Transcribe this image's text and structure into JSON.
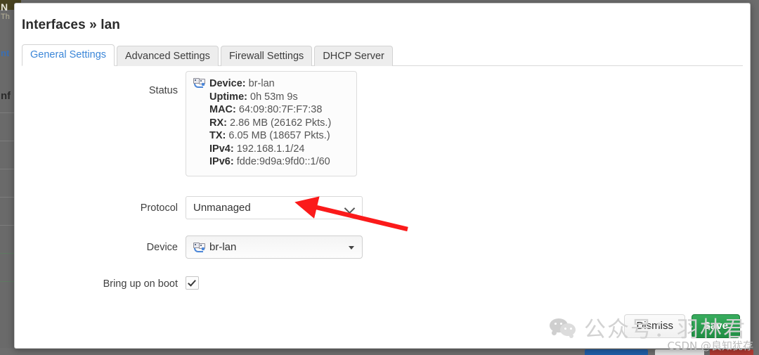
{
  "window": {
    "title": "Interfaces » lan"
  },
  "tabs": [
    {
      "label": "General Settings",
      "active": true
    },
    {
      "label": "Advanced Settings",
      "active": false
    },
    {
      "label": "Firewall Settings",
      "active": false
    },
    {
      "label": "DHCP Server",
      "active": false
    }
  ],
  "form": {
    "status": {
      "label": "Status",
      "icon": "network-interface-icon",
      "lines": [
        {
          "key": "Device:",
          "value": "br-lan"
        },
        {
          "key": "Uptime:",
          "value": "0h 53m 9s"
        },
        {
          "key": "MAC:",
          "value": "64:09:80:7F:F7:38"
        },
        {
          "key": "RX:",
          "value": "2.86 MB (26162 Pkts.)"
        },
        {
          "key": "TX:",
          "value": "6.05 MB (18657 Pkts.)"
        },
        {
          "key": "IPv4:",
          "value": "192.168.1.1/24"
        },
        {
          "key": "IPv6:",
          "value": "fdde:9d9a:9fd0::1/60"
        }
      ]
    },
    "protocol": {
      "label": "Protocol",
      "value": "Unmanaged"
    },
    "device": {
      "label": "Device",
      "value": "br-lan",
      "icon": "network-interface-icon"
    },
    "bring_up_on_boot": {
      "label": "Bring up on boot",
      "checked": true
    }
  },
  "footer": {
    "dismiss_label": "Dismiss",
    "save_label": "Save"
  },
  "watermark": {
    "wechat_text": "公众号：羽林君",
    "csdn_text": "CSDN @良知犹存"
  },
  "background": {
    "fragments": [
      "N",
      "Th",
      "nt",
      "nf"
    ]
  },
  "colors": {
    "accent_blue": "#3b86d8",
    "save_green": "#1f8e43",
    "arrow_red": "#fb1a1a",
    "modal_border": "#c9c9c9",
    "page_backdrop": "#6d6d6d"
  }
}
